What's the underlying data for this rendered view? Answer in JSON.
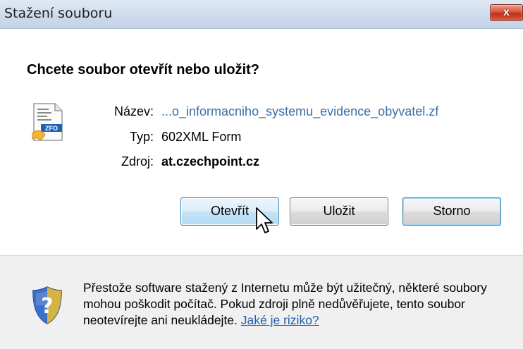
{
  "window": {
    "title": "Stažení souboru",
    "close_symbol": "x"
  },
  "dialog": {
    "question": "Chcete soubor otevřít nebo uložit?",
    "file": {
      "icon": "zfo-file-icon",
      "name_label": "Název:",
      "name_value": "...o_informacniho_systemu_evidence_obyvatel.zf",
      "type_label": "Typ:",
      "type_value": "602XML Form",
      "source_label": "Zdroj:",
      "source_value": "at.czechpoint.cz"
    },
    "buttons": {
      "open": "Otevřít",
      "save": "Uložit",
      "cancel": "Storno"
    }
  },
  "footer": {
    "icon": "shield-question-icon",
    "warning_text": "Přestože software stažený z Internetu může být užitečný, některé soubory mohou poškodit počítač. Pokud zdroji plně nedůvěřujete, tento soubor neotevírejte ani neukládejte.",
    "risk_link": "Jaké je riziko?"
  },
  "colors": {
    "titlebar": "#cfdcec",
    "link": "#3a6ea5",
    "close_button": "#c2301a"
  }
}
